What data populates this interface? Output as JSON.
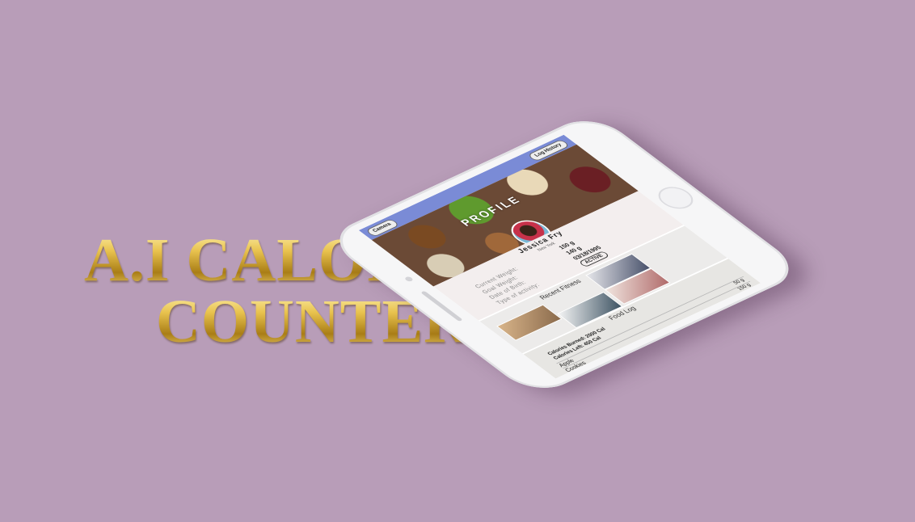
{
  "title": {
    "line1": "A.I CALORIE",
    "line2": "COUNTER"
  },
  "app": {
    "header": {
      "camera_label": "Camera",
      "history_label": "Log History",
      "color": "#7a8bd6"
    },
    "profile": {
      "banner_title": "PROFILE",
      "name": "Jessica Fry",
      "location": "New York",
      "fields": [
        {
          "label": "Current Weight:",
          "value": "150 g"
        },
        {
          "label": "Goal Weight:",
          "value": "140 g"
        },
        {
          "label": "Date of Birth:",
          "value": "03/18/1995"
        },
        {
          "label": "Type of activity:",
          "value": "ACTIVE"
        }
      ]
    },
    "fitness": {
      "title": "Recent Fitness"
    },
    "food_log": {
      "title": "Food Log",
      "calories_burned": "Calories Burned: 2000 Cal",
      "calories_left": "Calories Left: 450 Cal",
      "items": [
        {
          "name": "Apple",
          "amount": "50 g"
        },
        {
          "name": "Cookies",
          "amount": "150 g"
        }
      ]
    }
  },
  "background_color": "#b89db8",
  "title_color": "#c8a43a"
}
